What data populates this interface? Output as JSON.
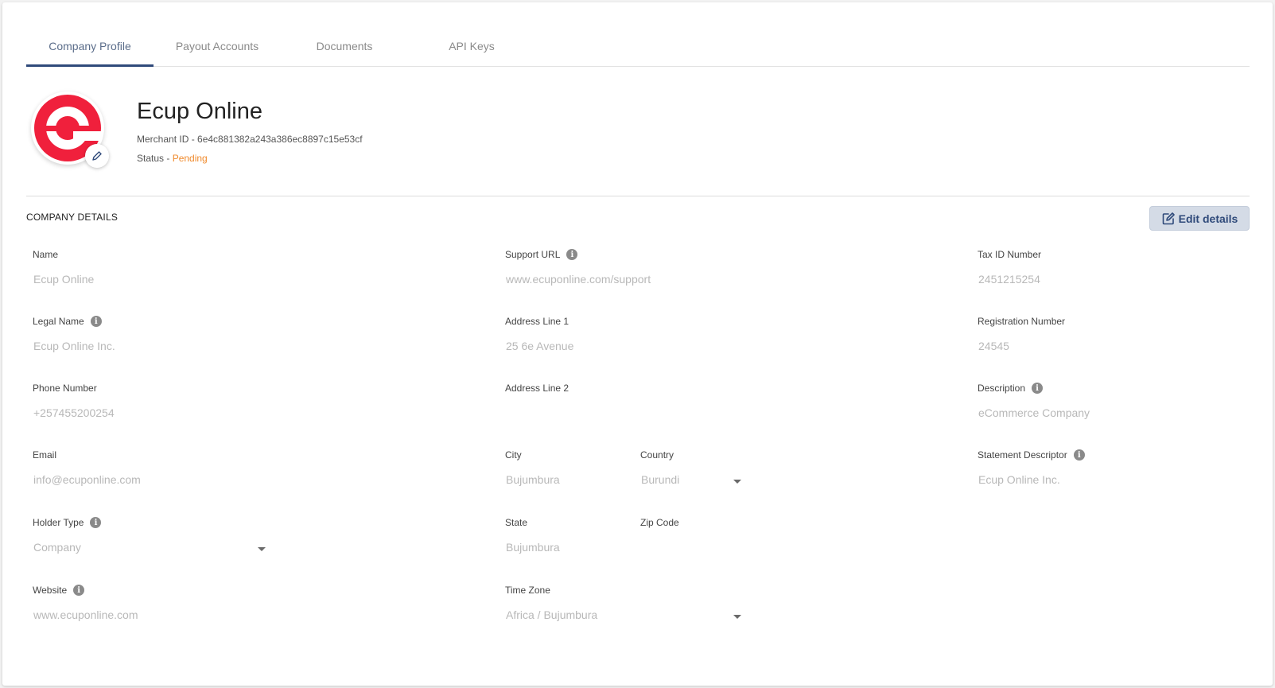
{
  "tabs": [
    {
      "label": "Company Profile"
    },
    {
      "label": "Payout Accounts"
    },
    {
      "label": "Documents"
    },
    {
      "label": "API Keys"
    }
  ],
  "profile": {
    "name": "Ecup Online",
    "merchant_id_label": "Merchant ID - ",
    "merchant_id": "6e4c881382a243a386ec8897c15e53cf",
    "status_label": "Status - ",
    "status": "Pending",
    "logo_color": "#f0203c"
  },
  "section": {
    "title": "COMPANY DETAILS",
    "edit_label": "Edit details"
  },
  "fields": {
    "name": {
      "label": "Name",
      "value": "Ecup Online"
    },
    "legal_name": {
      "label": "Legal Name",
      "value": "Ecup Online Inc."
    },
    "phone": {
      "label": "Phone Number",
      "value": "+257455200254"
    },
    "email": {
      "label": "Email",
      "value": "info@ecuponline.com"
    },
    "holder_type": {
      "label": "Holder Type",
      "value": "Company"
    },
    "website": {
      "label": "Website",
      "value": "www.ecuponline.com"
    },
    "support_url": {
      "label": "Support URL",
      "value": "www.ecuponline.com/support"
    },
    "address1": {
      "label": "Address Line 1",
      "value": "25 6e Avenue"
    },
    "address2": {
      "label": "Address Line 2",
      "value": ""
    },
    "city": {
      "label": "City",
      "value": "Bujumbura"
    },
    "country": {
      "label": "Country",
      "value": "Burundi"
    },
    "state": {
      "label": "State",
      "value": "Bujumbura"
    },
    "zip": {
      "label": "Zip Code",
      "value": ""
    },
    "timezone": {
      "label": "Time Zone",
      "value": "Africa / Bujumbura"
    },
    "tax_id": {
      "label": "Tax ID Number",
      "value": "2451215254"
    },
    "registration": {
      "label": "Registration Number",
      "value": "24545"
    },
    "description": {
      "label": "Description",
      "value": "eCommerce Company"
    },
    "statement_descriptor": {
      "label": "Statement Descriptor",
      "value": "Ecup Online Inc."
    }
  },
  "icons": {
    "info": "info-icon",
    "edit": "pencil-icon",
    "dropdown": "caret-down-icon"
  },
  "colors": {
    "accent": "#2f4a7a",
    "status_pending": "#f08a2c"
  }
}
